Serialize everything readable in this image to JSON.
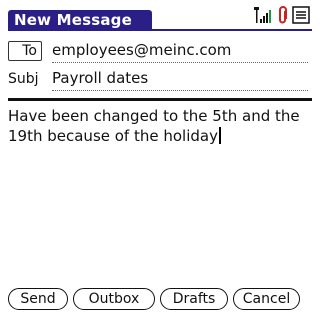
{
  "app": {
    "title": "New Message"
  },
  "status": {
    "icons": [
      "signal-strength-icon",
      "attachment-icon",
      "menu-icon"
    ],
    "colors": {
      "title_bg": "#2a1f86",
      "attachment": "#cc2222"
    }
  },
  "fields": {
    "to": {
      "label": "To",
      "value": "employees@meinc.com"
    },
    "subject": {
      "label": "Subj",
      "value": "Payroll dates"
    }
  },
  "message": {
    "body": "Have been changed to the 5th and the 19th because of the holiday"
  },
  "buttons": {
    "send": "Send",
    "outbox": "Outbox",
    "drafts": "Drafts",
    "cancel": "Cancel"
  }
}
